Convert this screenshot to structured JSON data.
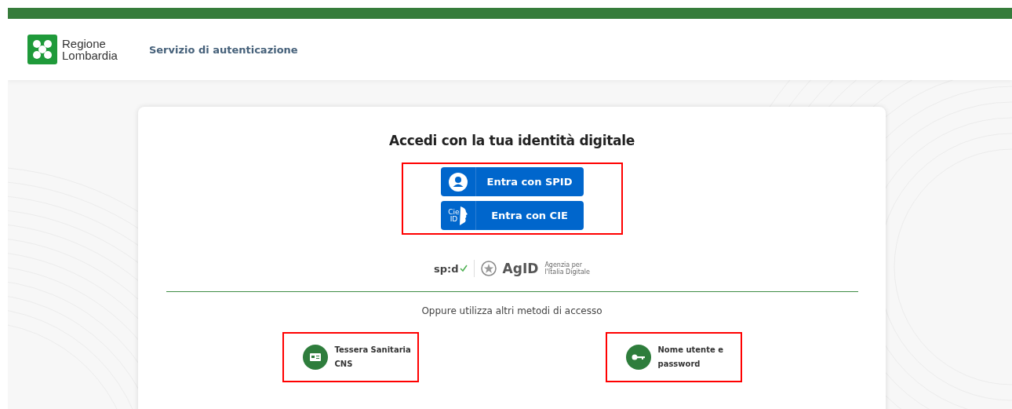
{
  "header": {
    "logo_line_1": "Regione",
    "logo_line_2": "Lombardia",
    "service_title": "Servizio di autenticazione"
  },
  "login_card": {
    "title": "Accedi con la tua identità digitale",
    "primary_methods": [
      {
        "kind": "spid",
        "label": "Entra con SPID"
      },
      {
        "kind": "cie",
        "icon_text_1": "Cie",
        "icon_text_2": "ID",
        "label": "Entra con CIE"
      }
    ],
    "logos": {
      "spid": "sp:d",
      "agid": "AgID",
      "agid_subtitle_1": "Agenzia per",
      "agid_subtitle_2": "l'Italia Digitale"
    },
    "alternative_caption": "Oppure utilizza altri metodi di accesso",
    "alternative_methods": [
      {
        "kind": "card",
        "line_1": "Tessera Sanitaria",
        "line_2": "CNS"
      },
      {
        "kind": "key",
        "line_1": "Nome utente e",
        "line_2": "password"
      }
    ]
  }
}
